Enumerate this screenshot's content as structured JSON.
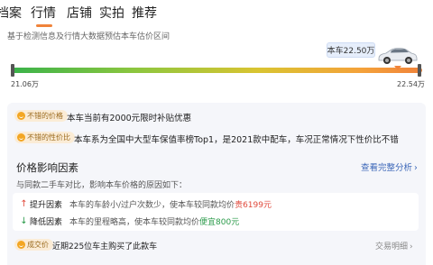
{
  "tabs": [
    {
      "label": "档案"
    },
    {
      "label": "行情"
    },
    {
      "label": "店铺"
    },
    {
      "label": "实拍"
    },
    {
      "label": "推荐"
    }
  ],
  "active_tab": 1,
  "hint": "基于检测信息及行情大数据预估本车估价区间",
  "price_badge": "本车22.50万",
  "range": {
    "min": "21.06万",
    "max": "22.54万",
    "position": 0.94
  },
  "highlights": [
    {
      "tag": "不错的价格",
      "text": "本车当前有2000元限时补贴优惠"
    },
    {
      "tag": "不错的性价比",
      "text": "本车系为全国中大型车保值率榜Top1，是2021款中配车，车况正常情况下性价比不错"
    }
  ],
  "factors": {
    "title": "价格影响因素",
    "link": "查看完整分析",
    "link_chevron": "›",
    "subtitle": "与同款二手车对比，影响本车价格的原因如下：",
    "items": [
      {
        "arrow": "↑",
        "label": "提升因素",
        "desc": "本车的车龄小/过户次数少，使本车较同款均价",
        "value": "贵6199元",
        "dir": "up"
      },
      {
        "arrow": "↓",
        "label": "降低因素",
        "desc": "本车的里程略高，使本车较同款均价",
        "value": "便宜800元",
        "dir": "down"
      }
    ]
  },
  "deal": {
    "tag": "成交价",
    "text": "近期225位车主购买了此款车",
    "link": "交易明细",
    "link_chevron": "›"
  },
  "colors": {
    "accent": "#f0833a",
    "up": "#e04a3c",
    "down": "#2a9a49",
    "link": "#3b66b8"
  }
}
